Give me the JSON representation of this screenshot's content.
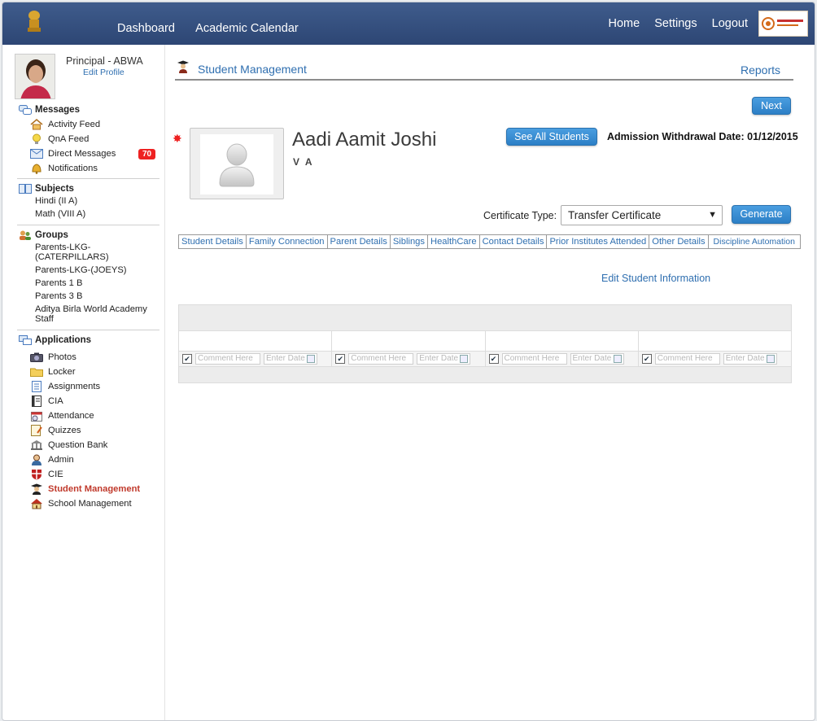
{
  "topnav": {
    "left_links": [
      "Dashboard",
      "Academic Calendar"
    ],
    "right_links": [
      "Home",
      "Settings",
      "Logout"
    ]
  },
  "profile": {
    "name": "Principal - ABWA",
    "edit_label": "Edit Profile"
  },
  "sidebar": {
    "messages": {
      "title": "Messages",
      "items": [
        {
          "label": "Activity Feed",
          "icon": "home-icon"
        },
        {
          "label": "QnA Feed",
          "icon": "bulb-icon"
        },
        {
          "label": "Direct Messages",
          "icon": "envelope-icon",
          "badge": "70"
        },
        {
          "label": "Notifications",
          "icon": "bell-icon"
        }
      ]
    },
    "subjects": {
      "title": "Subjects",
      "items": [
        "Hindi (II A)",
        "Math (VIII A)"
      ]
    },
    "groups": {
      "title": "Groups",
      "items": [
        "Parents-LKG-(CATERPILLARS)",
        "Parents-LKG-(JOEYS)",
        "Parents 1 B",
        "Parents 3 B",
        "Aditya Birla World Academy Staff"
      ]
    },
    "applications": {
      "title": "Applications",
      "items": [
        {
          "label": "Photos",
          "icon": "camera-icon"
        },
        {
          "label": "Locker",
          "icon": "folder-icon"
        },
        {
          "label": "Assignments",
          "icon": "document-icon"
        },
        {
          "label": "CIA",
          "icon": "notebook-icon"
        },
        {
          "label": "Attendance",
          "icon": "calendar-check-icon"
        },
        {
          "label": "Quizzes",
          "icon": "quiz-icon"
        },
        {
          "label": "Question Bank",
          "icon": "bank-icon"
        },
        {
          "label": "Admin",
          "icon": "admin-user-icon"
        },
        {
          "label": "CIE",
          "icon": "shield-icon"
        },
        {
          "label": "Student Management",
          "icon": "graduate-icon",
          "active": true
        },
        {
          "label": "School Management",
          "icon": "school-icon"
        }
      ]
    }
  },
  "main": {
    "title": "Student Management",
    "reports_label": "Reports",
    "next_label": "Next",
    "see_all_label": "See All Students",
    "student": {
      "name": "Aadi Aamit Joshi",
      "class": "V A",
      "withdrawal": "Admission Withdrawal Date: 01/12/2015"
    },
    "certificate": {
      "label": "Certificate Type:",
      "selected": "Transfer Certificate",
      "generate_label": "Generate"
    },
    "tabs": [
      "Student Details",
      "Family Connection",
      "Parent Details",
      "Siblings",
      "HealthCare",
      "Contact Details",
      "Prior Institutes Attended",
      "Other Details",
      "Discipline Automation"
    ],
    "edit_info_label": "Edit Student Information",
    "grid": {
      "comment_placeholder": "Comment Here",
      "date_placeholder": "Enter Date"
    }
  },
  "colors": {
    "header_bg": "#2d4674",
    "link_blue": "#2f6fb0",
    "button_blue": "#3a8fd6",
    "active_red": "#c0392b",
    "badge_red": "#e22222"
  }
}
